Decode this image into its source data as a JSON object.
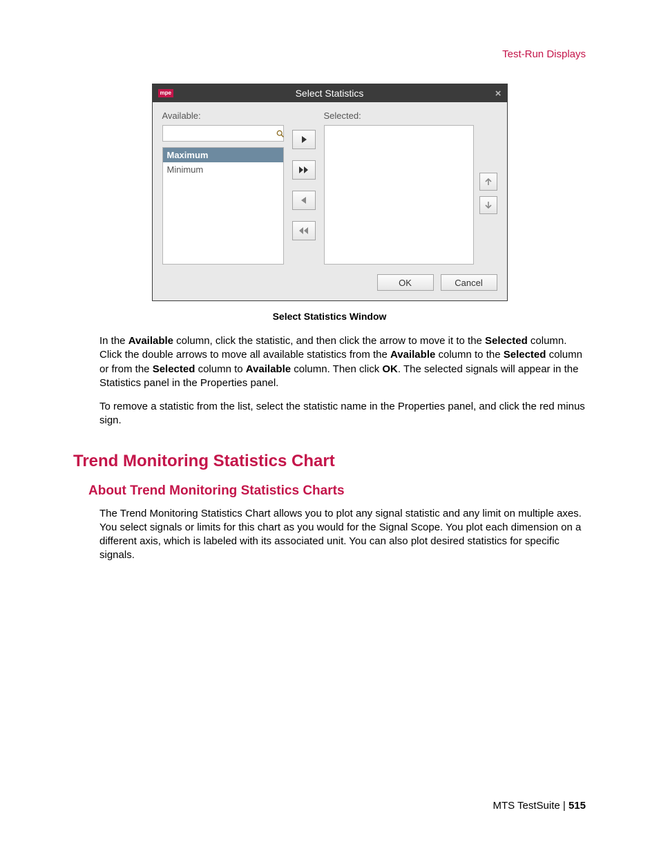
{
  "header": {
    "breadcrumb": "Test-Run Displays"
  },
  "dialog": {
    "logo": "mpe",
    "title": "Select Statistics",
    "close": "×",
    "available_label": "Available:",
    "selected_label": "Selected:",
    "search_value": "",
    "items": [
      {
        "label": "Maximum",
        "selected": true
      },
      {
        "label": "Minimum",
        "selected": false
      }
    ],
    "ok": "OK",
    "cancel": "Cancel"
  },
  "caption": "Select Statistics Window",
  "para1_pre": "In the ",
  "para1_b1": "Available",
  "para1_mid1": " column, click the statistic, and then click the arrow to move it to the ",
  "para1_b2": "Selected",
  "para1_mid2": " column. Click the double arrows to move all available statistics from the ",
  "para1_b3": "Available",
  "para1_mid3": " column to the ",
  "para1_b4": "Selected",
  "para1_mid4": " column or from the ",
  "para1_b5": "Selected",
  "para1_mid5": " column to ",
  "para1_b6": "Available",
  "para1_mid6": " column. Then click ",
  "para1_b7": "OK",
  "para1_end": ". The selected signals will appear in the Statistics panel in the Properties panel.",
  "para2": "To remove a statistic from the list, select the statistic name in the Properties panel, and click the red minus sign.",
  "h2": "Trend Monitoring Statistics Chart",
  "h3": "About Trend Monitoring Statistics Charts",
  "para3": "The Trend Monitoring Statistics Chart allows you to plot any signal statistic and any limit on multiple axes. You select signals or limits for this chart as you would for the Signal Scope. You plot each dimension on a different axis, which is labeled with its associated unit. You can also plot desired statistics for specific signals.",
  "footer_product": "MTS TestSuite | ",
  "footer_page": "515"
}
